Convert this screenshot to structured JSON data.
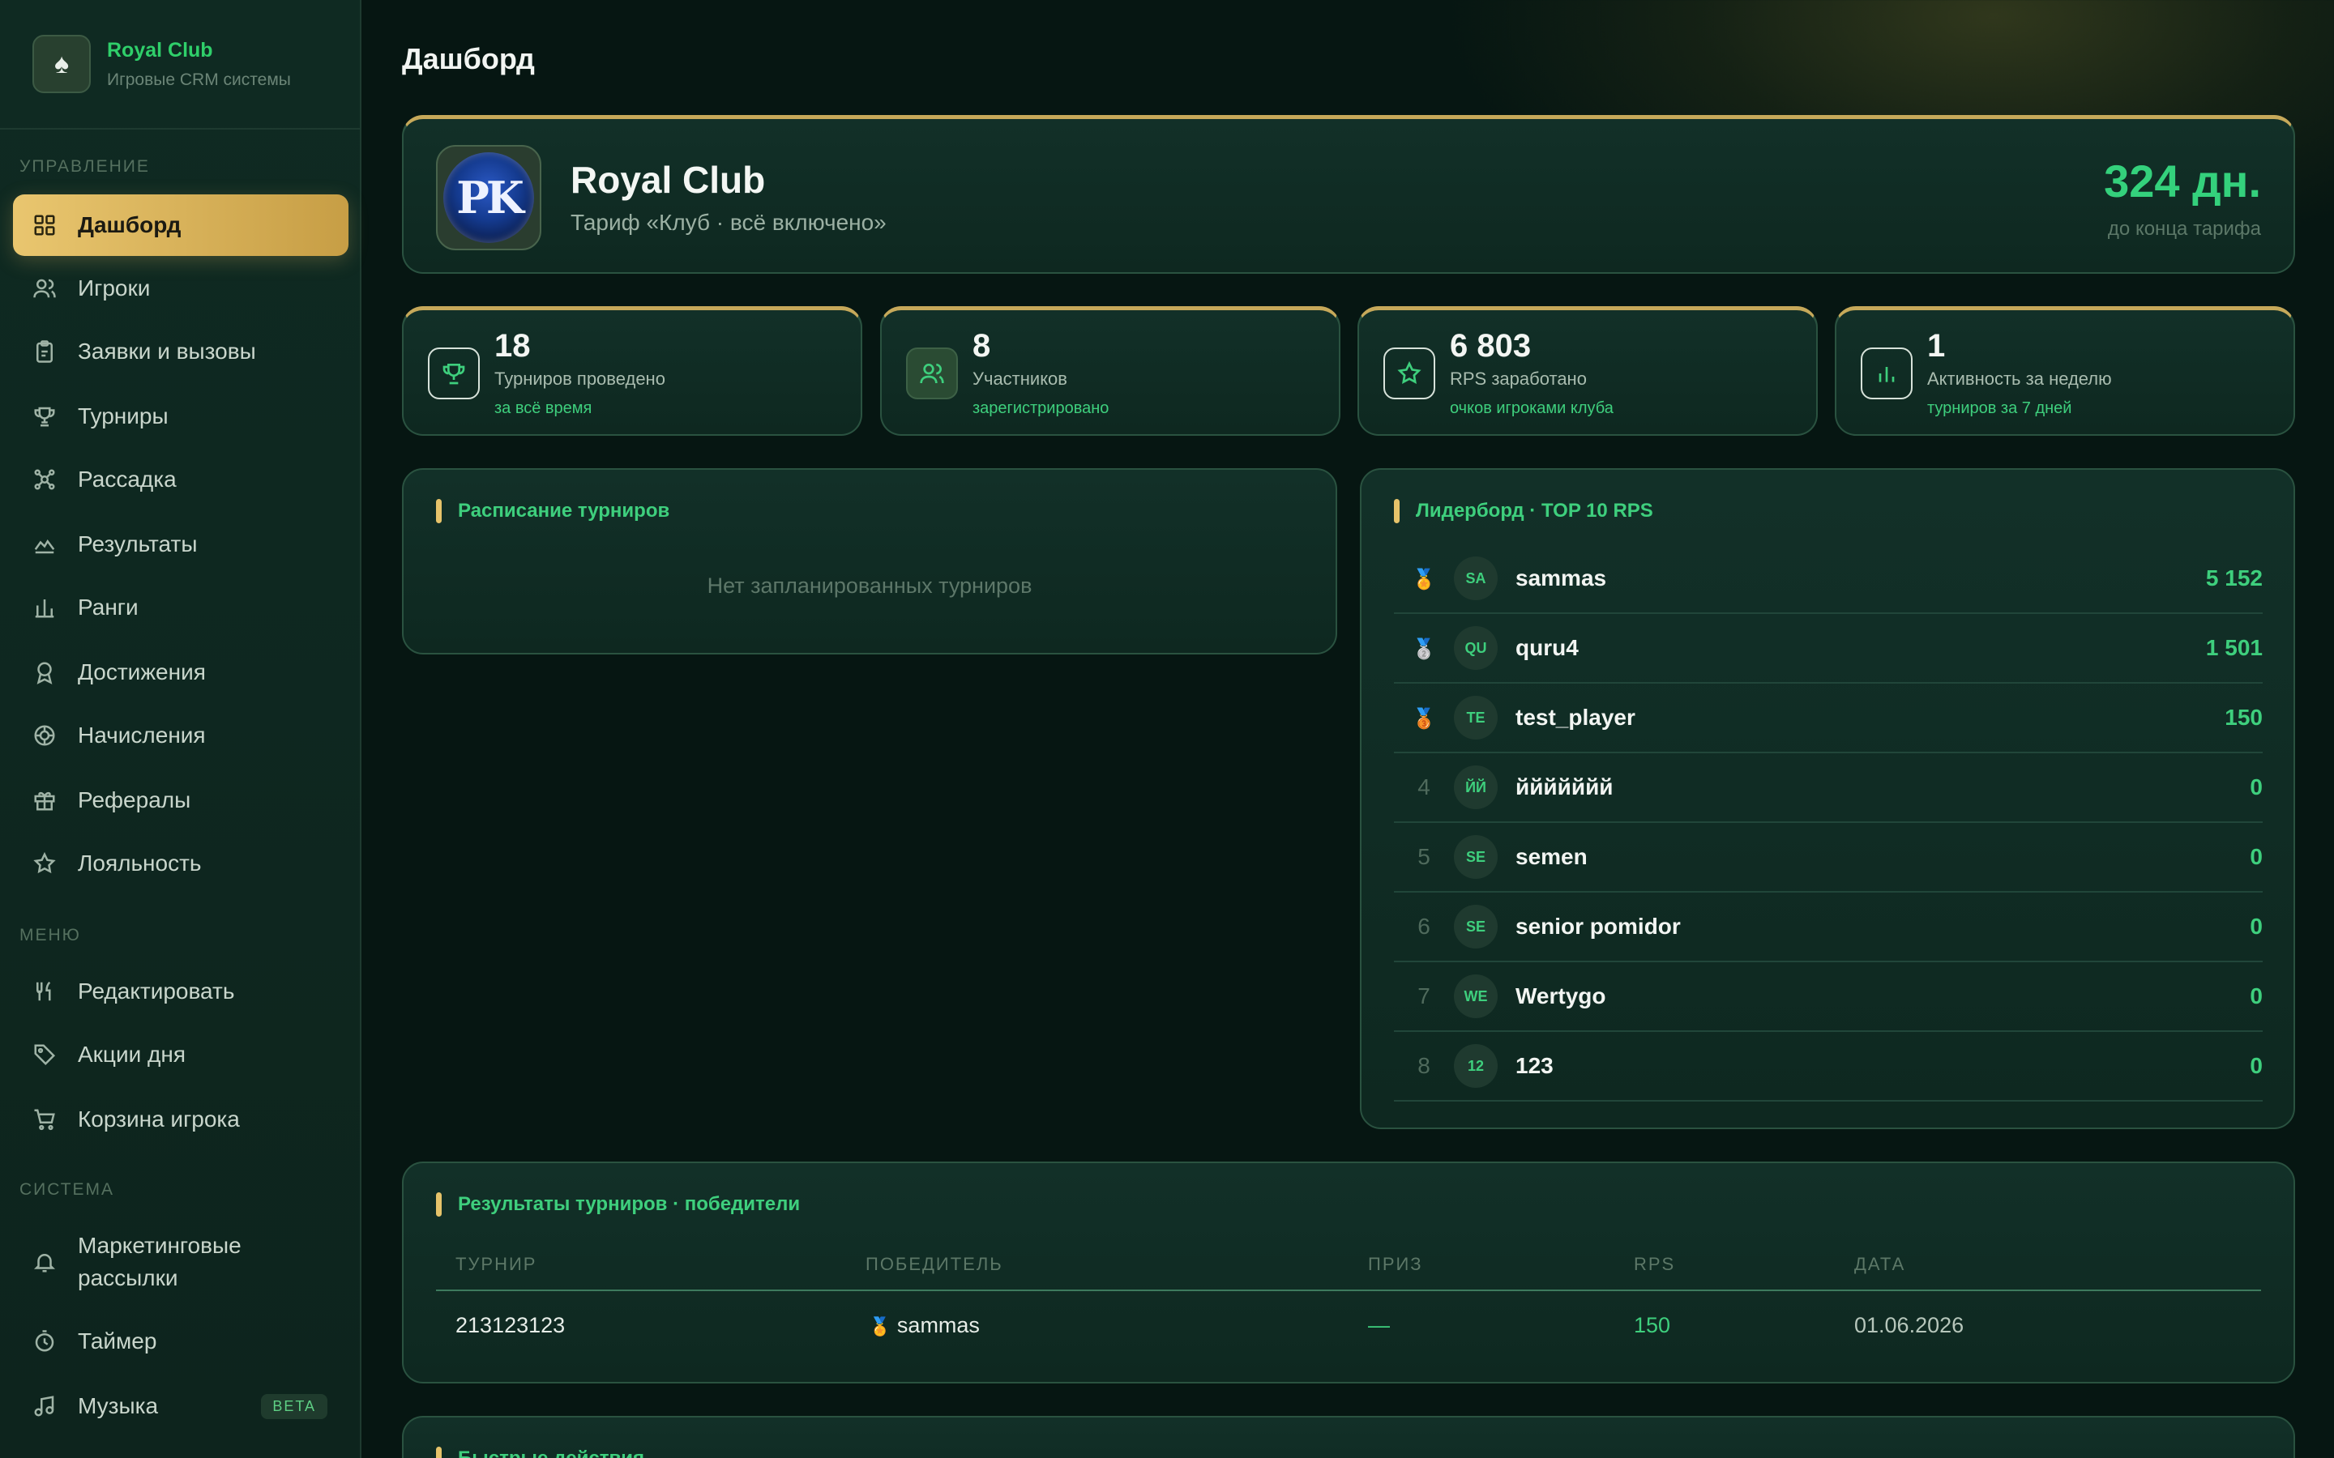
{
  "brand": {
    "title": "Royal Club",
    "subtitle": "Игровые CRM системы"
  },
  "sidebar": {
    "sections": [
      "УПРАВЛЕНИЕ",
      "МЕНЮ",
      "СИСТЕМА"
    ],
    "items": [
      {
        "label": "Дашборд",
        "icon": "grid-icon",
        "active": true
      },
      {
        "label": "Игроки",
        "icon": "users-icon"
      },
      {
        "label": "Заявки и вызовы",
        "icon": "clipboard-icon"
      },
      {
        "label": "Турниры",
        "icon": "trophy-icon"
      },
      {
        "label": "Рассадка",
        "icon": "seating-icon"
      },
      {
        "label": "Результаты",
        "icon": "chart-area-icon"
      },
      {
        "label": "Ранги",
        "icon": "bar-chart-icon"
      },
      {
        "label": "Достижения",
        "icon": "award-icon"
      },
      {
        "label": "Начисления",
        "icon": "coins-icon"
      },
      {
        "label": "Рефералы",
        "icon": "gift-icon"
      },
      {
        "label": "Лояльность",
        "icon": "star-icon"
      },
      {
        "label": "Редактировать",
        "icon": "utensils-icon"
      },
      {
        "label": "Акции дня",
        "icon": "tag-icon"
      },
      {
        "label": "Корзина игрока",
        "icon": "cart-icon"
      },
      {
        "label": "Маркетинговые рассылки",
        "icon": "bell-icon"
      },
      {
        "label": "Таймер",
        "icon": "timer-icon"
      },
      {
        "label": "Музыка",
        "icon": "music-icon",
        "badge": "BETA"
      }
    ]
  },
  "page": {
    "title": "Дашборд"
  },
  "club": {
    "name": "Royal Club",
    "plan": "Тариф «Клуб · всё включено»",
    "logo_text": "PK",
    "days_left": "324 дн.",
    "days_label": "до конца тарифа"
  },
  "stats": [
    {
      "value": "18",
      "label": "Турниров проведено",
      "sub": "за всё время",
      "icon": "trophy-icon"
    },
    {
      "value": "8",
      "label": "Участников",
      "sub": "зарегистрировано",
      "icon": "users-icon"
    },
    {
      "value": "6 803",
      "label": "RPS заработано",
      "sub": "очков игроками клуба",
      "icon": "star-icon"
    },
    {
      "value": "1",
      "label": "Активность за неделю",
      "sub": "турниров за 7 дней",
      "icon": "bar-chart-icon"
    }
  ],
  "schedule": {
    "title": "Расписание турниров",
    "empty": "Нет запланированных турниров"
  },
  "leaderboard": {
    "title": "Лидерборд · TOP 10 RPS",
    "rows": [
      {
        "rank": "1",
        "medal": "gold",
        "initials": "SA",
        "name": "sammas",
        "score": "5 152"
      },
      {
        "rank": "2",
        "medal": "silver",
        "initials": "QU",
        "name": "quru4",
        "score": "1 501"
      },
      {
        "rank": "3",
        "medal": "bronze",
        "initials": "TE",
        "name": "test_player",
        "score": "150"
      },
      {
        "rank": "4",
        "initials": "ЙЙ",
        "name": "ййййййй",
        "score": "0"
      },
      {
        "rank": "5",
        "initials": "SE",
        "name": "semen",
        "score": "0"
      },
      {
        "rank": "6",
        "initials": "SE",
        "name": "senior pomidor",
        "score": "0"
      },
      {
        "rank": "7",
        "initials": "WE",
        "name": "Wertygo",
        "score": "0"
      },
      {
        "rank": "8",
        "initials": "12",
        "name": "123",
        "score": "0"
      }
    ]
  },
  "results": {
    "title": "Результаты турниров · победители",
    "columns": [
      "ТУРНИР",
      "ПОБЕДИТЕЛЬ",
      "ПРИЗ",
      "RPS",
      "ДАТА"
    ],
    "rows": [
      {
        "tournament": "213123123",
        "winner": "sammas",
        "prize": "—",
        "rps": "150",
        "date": "01.06.2026"
      }
    ]
  },
  "quick": {
    "title": "Быстрые действия"
  },
  "colors": {
    "accent": "#3ecf7d",
    "gold": "#e6c36a",
    "background": "#061612"
  }
}
